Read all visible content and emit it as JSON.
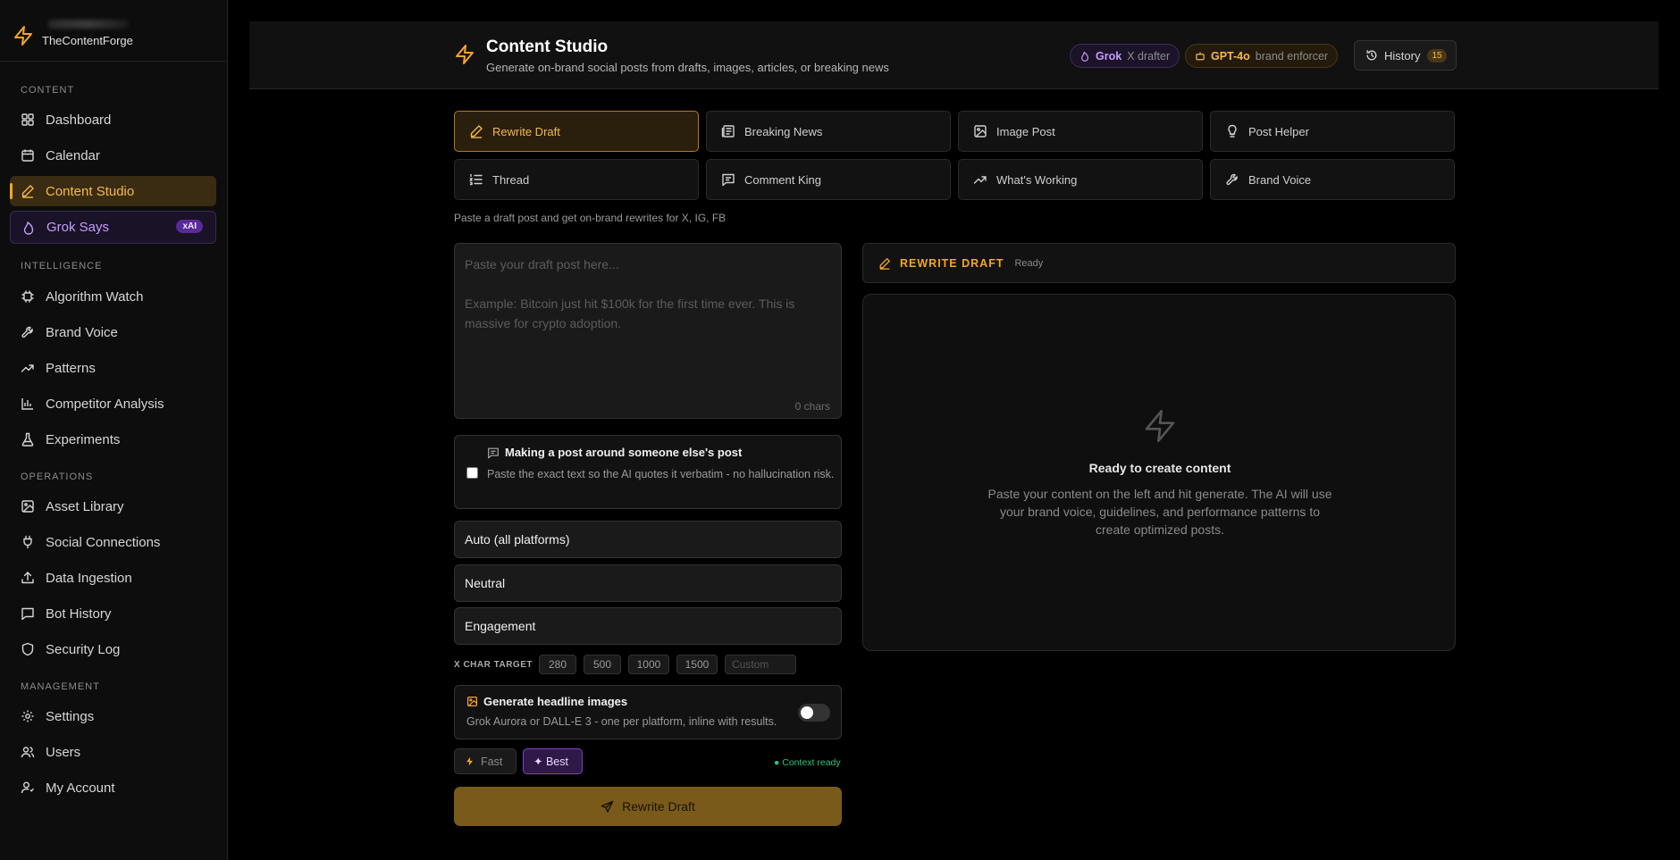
{
  "app": {
    "name": "TheContentForge"
  },
  "sidebar": {
    "sections": {
      "content": "CONTENT",
      "intelligence": "INTELLIGENCE",
      "operations": "OPERATIONS",
      "management": "MANAGEMENT"
    },
    "items": [
      {
        "label": "Dashboard",
        "icon": "dashboard-icon"
      },
      {
        "label": "Calendar",
        "icon": "calendar-icon"
      },
      {
        "label": "Content Studio",
        "icon": "pencil-icon"
      },
      {
        "label": "Grok Says",
        "icon": "flame-icon",
        "badge": "xAI"
      },
      {
        "label": "Algorithm Watch",
        "icon": "cpu-icon"
      },
      {
        "label": "Brand Voice",
        "icon": "wrench-icon"
      },
      {
        "label": "Patterns",
        "icon": "trending-up-icon"
      },
      {
        "label": "Competitor Analysis",
        "icon": "bar-chart-icon"
      },
      {
        "label": "Experiments",
        "icon": "flask-icon"
      },
      {
        "label": "Asset Library",
        "icon": "image-icon"
      },
      {
        "label": "Social Connections",
        "icon": "plug-icon"
      },
      {
        "label": "Data Ingestion",
        "icon": "upload-icon"
      },
      {
        "label": "Bot History",
        "icon": "message-icon"
      },
      {
        "label": "Security Log",
        "icon": "shield-icon"
      },
      {
        "label": "Settings",
        "icon": "gear-icon"
      },
      {
        "label": "Users",
        "icon": "users-icon"
      },
      {
        "label": "My Account",
        "icon": "user-icon"
      }
    ]
  },
  "header": {
    "title": "Content Studio",
    "subtitle": "Generate on-brand social posts from drafts, images, articles, or breaking news",
    "grok_pill": {
      "name": "Grok",
      "role": "X drafter"
    },
    "gpt_pill": {
      "name": "GPT-4o",
      "role": "brand enforcer"
    },
    "history": {
      "label": "History",
      "count": "15"
    }
  },
  "tabs": [
    {
      "label": "Rewrite Draft",
      "icon": "pencil-icon",
      "active": true
    },
    {
      "label": "Breaking News",
      "icon": "newspaper-icon"
    },
    {
      "label": "Image Post",
      "icon": "image-icon"
    },
    {
      "label": "Post Helper",
      "icon": "lightbulb-icon"
    },
    {
      "label": "Thread",
      "icon": "list-icon"
    },
    {
      "label": "Comment King",
      "icon": "comment-icon"
    },
    {
      "label": "What's Working",
      "icon": "trending-up-icon"
    },
    {
      "label": "Brand Voice",
      "icon": "wrench-icon"
    }
  ],
  "helper_text": "Paste a draft post and get on-brand rewrites for X, IG, FB",
  "draft": {
    "placeholder": "Paste your draft post here...\n\nExample: Bitcoin just hit $100k for the first time ever. This is massive for crypto adoption.",
    "value": "",
    "char_count": "0 chars"
  },
  "quote": {
    "title": "Making a post around someone else's post",
    "description": "Paste the exact text so the AI quotes it verbatim - no hallucination risk.",
    "checked": false
  },
  "selects": {
    "platform": "Auto (all platforms)",
    "tone": "Neutral",
    "goal": "Engagement"
  },
  "char_target": {
    "label": "X CHAR TARGET",
    "options": [
      "280",
      "500",
      "1000",
      "1500"
    ],
    "custom_placeholder": "Custom"
  },
  "images": {
    "title": "Generate headline images",
    "description": "Grok Aurora or DALL-E 3 - one per platform, inline with results.",
    "enabled": false
  },
  "modes": {
    "fast": "Fast",
    "best": "✦ Best"
  },
  "context_status": "● Context ready",
  "submit_label": "Rewrite Draft",
  "output": {
    "title": "REWRITE DRAFT",
    "status": "Ready",
    "empty_title": "Ready to create content",
    "empty_desc": "Paste your content on the left and hit generate. The AI will use your brand voice, guidelines, and performance patterns to create optimized posts."
  },
  "colors": {
    "accent": "#f5a623",
    "grok": "#c69cff",
    "success": "#2ec27e"
  }
}
